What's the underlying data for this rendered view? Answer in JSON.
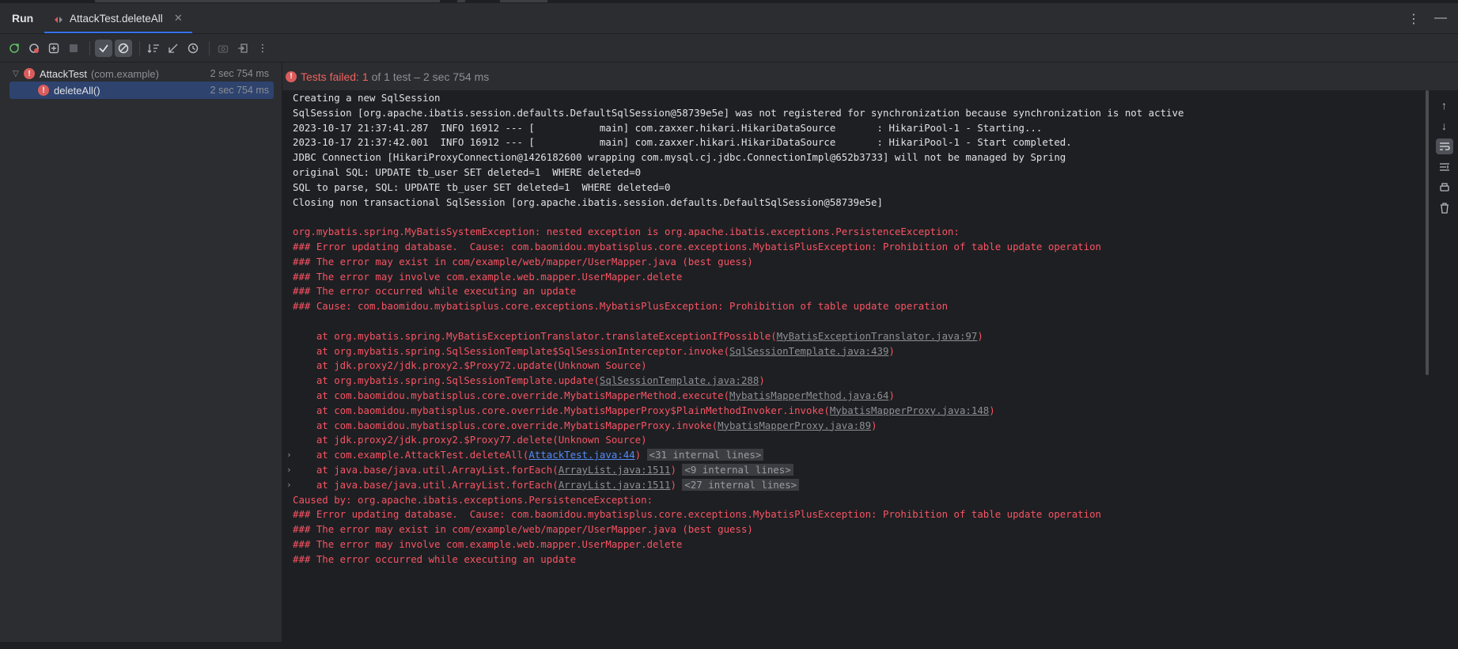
{
  "header": {
    "run_title": "Run",
    "tab_label": "AttackTest.deleteAll"
  },
  "toolbar": {
    "buttons": [
      "rerun-icon",
      "rerun-failed-icon",
      "toggle-auto-test-icon",
      "stop-icon",
      "show-passed-icon",
      "show-ignored-icon",
      "sort-alpha-icon",
      "sort-duration-icon",
      "history-icon",
      "export-icon",
      "import-icon",
      "more-icon"
    ]
  },
  "tree": {
    "root": {
      "name": "AttackTest",
      "package": "(com.example)",
      "time": "2 sec 754 ms"
    },
    "child": {
      "name": "deleteAll()",
      "time": "2 sec 754 ms"
    }
  },
  "status": {
    "failed_text": "Tests failed: 1",
    "rest_text": "of 1 test – 2 sec 754 ms"
  },
  "console": {
    "lines": [
      {
        "t": "Creating a new SqlSession",
        "err": false
      },
      {
        "t": "SqlSession [org.apache.ibatis.session.defaults.DefaultSqlSession@58739e5e] was not registered for synchronization because synchronization is not active",
        "err": false
      },
      {
        "t": "2023-10-17 21:37:41.287  INFO 16912 --- [           main] com.zaxxer.hikari.HikariDataSource       : HikariPool-1 - Starting...",
        "err": false
      },
      {
        "t": "2023-10-17 21:37:42.001  INFO 16912 --- [           main] com.zaxxer.hikari.HikariDataSource       : HikariPool-1 - Start completed.",
        "err": false
      },
      {
        "t": "JDBC Connection [HikariProxyConnection@1426182600 wrapping com.mysql.cj.jdbc.ConnectionImpl@652b3733] will not be managed by Spring",
        "err": false
      },
      {
        "t": "original SQL: UPDATE tb_user SET deleted=1  WHERE deleted=0",
        "err": false
      },
      {
        "t": "SQL to parse, SQL: UPDATE tb_user SET deleted=1  WHERE deleted=0",
        "err": false
      },
      {
        "t": "Closing non transactional SqlSession [org.apache.ibatis.session.defaults.DefaultSqlSession@58739e5e]",
        "err": false
      },
      {
        "t": "",
        "err": false
      },
      {
        "t": "org.mybatis.spring.MyBatisSystemException: nested exception is org.apache.ibatis.exceptions.PersistenceException: ",
        "err": true
      },
      {
        "t": "### Error updating database.  Cause: com.baomidou.mybatisplus.core.exceptions.MybatisPlusException: Prohibition of table update operation",
        "err": true
      },
      {
        "t": "### The error may exist in com/example/web/mapper/UserMapper.java (best guess)",
        "err": true
      },
      {
        "t": "### The error may involve com.example.web.mapper.UserMapper.delete",
        "err": true
      },
      {
        "t": "### The error occurred while executing an update",
        "err": true
      },
      {
        "t": "### Cause: com.baomidou.mybatisplus.core.exceptions.MybatisPlusException: Prohibition of table update operation",
        "err": true
      },
      {
        "t": "",
        "err": false
      }
    ],
    "stack": [
      {
        "pre": "    at org.mybatis.spring.MyBatisExceptionTranslator.translateExceptionIfPossible(",
        "link": "MyBatisExceptionTranslator.java:97",
        "post": ")"
      },
      {
        "pre": "    at org.mybatis.spring.SqlSessionTemplate$SqlSessionInterceptor.invoke(",
        "link": "SqlSessionTemplate.java:439",
        "post": ")"
      },
      {
        "pre": "    at jdk.proxy2/jdk.proxy2.$Proxy72.update(Unknown Source)",
        "link": "",
        "post": ""
      },
      {
        "pre": "    at org.mybatis.spring.SqlSessionTemplate.update(",
        "link": "SqlSessionTemplate.java:288",
        "post": ")"
      },
      {
        "pre": "    at com.baomidou.mybatisplus.core.override.MybatisMapperMethod.execute(",
        "link": "MybatisMapperMethod.java:64",
        "post": ")"
      },
      {
        "pre": "    at com.baomidou.mybatisplus.core.override.MybatisMapperProxy$PlainMethodInvoker.invoke(",
        "link": "MybatisMapperProxy.java:148",
        "post": ")"
      },
      {
        "pre": "    at com.baomidou.mybatisplus.core.override.MybatisMapperProxy.invoke(",
        "link": "MybatisMapperProxy.java:89",
        "post": ")"
      },
      {
        "pre": "    at jdk.proxy2/jdk.proxy2.$Proxy77.delete(Unknown Source)",
        "link": "",
        "post": ""
      }
    ],
    "collapsed": [
      {
        "pre": "    at com.example.AttackTest.deleteAll(",
        "link": "AttackTest.java:44",
        "post": ")",
        "internal": "<31 internal lines>",
        "blue": true
      },
      {
        "pre": "    at java.base/java.util.ArrayList.forEach(",
        "link": "ArrayList.java:1511",
        "post": ")",
        "internal": "<9 internal lines>",
        "blue": false
      },
      {
        "pre": "    at java.base/java.util.ArrayList.forEach(",
        "link": "ArrayList.java:1511",
        "post": ")",
        "internal": "<27 internal lines>",
        "blue": false
      }
    ],
    "tail": [
      {
        "t": "Caused by: org.apache.ibatis.exceptions.PersistenceException: ",
        "err": true
      },
      {
        "t": "### Error updating database.  Cause: com.baomidou.mybatisplus.core.exceptions.MybatisPlusException: Prohibition of table update operation",
        "err": true
      },
      {
        "t": "### The error may exist in com/example/web/mapper/UserMapper.java (best guess)",
        "err": true
      },
      {
        "t": "### The error may involve com.example.web.mapper.UserMapper.delete",
        "err": true
      },
      {
        "t": "### The error occurred while executing an update",
        "err": true
      }
    ]
  },
  "colors": {
    "accent": "#3574f0",
    "error": "#f75464",
    "fail_icon": "#db5c5c",
    "link_blue": "#548af7"
  }
}
